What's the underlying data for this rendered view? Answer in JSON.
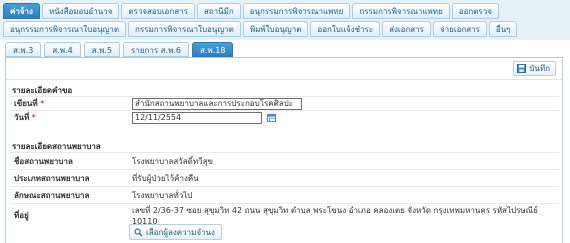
{
  "tabs_row1": [
    {
      "label": "ค่าจ้าง",
      "active": true
    },
    {
      "label": "หนังสือมอบอำนาจ",
      "active": false
    },
    {
      "label": "ตรวจสอบเอกสาร",
      "active": false
    },
    {
      "label": "สถานีมีก",
      "active": false
    },
    {
      "label": "อนุกรรมการพิจารณาแพทย",
      "active": false
    },
    {
      "label": "กรรมการพิจารณาแพทย",
      "active": false
    },
    {
      "label": "ออกตรวจ",
      "active": false
    }
  ],
  "tabs_row2": [
    {
      "label": "อนุกรรมการพิจารณาใบอนุญาต",
      "active": false
    },
    {
      "label": "กรรมการพิจารณาใบอนุญาต",
      "active": false
    },
    {
      "label": "พิมพ์ใบอนุญาต",
      "active": false
    },
    {
      "label": "ออกใบแจ้งชำระ",
      "active": false
    },
    {
      "label": "ส่งเอกสาร",
      "active": false
    },
    {
      "label": "จ่ายเอกสาร",
      "active": false
    },
    {
      "label": "อื่นๆ",
      "active": false
    }
  ],
  "subtabs": [
    {
      "label": "ส.พ.3",
      "active": false
    },
    {
      "label": "ส.พ.4",
      "active": false
    },
    {
      "label": "ส.พ.5",
      "active": false
    },
    {
      "label": "รายการ ส.พ.6",
      "active": false
    },
    {
      "label": "ส.พ.18",
      "active": true
    }
  ],
  "toolbar": {
    "save_label": "บันทึก"
  },
  "request_section": {
    "title": "รายละเอียดคำขอ",
    "write_at_label": "เขียนที่",
    "write_at_value": "สำนักสถานพยาบาลและการประกอบโรคศิลปะ",
    "date_label": "วันที่",
    "date_value": "12/11/2554"
  },
  "hospital_section": {
    "title": "รายละเอียดสถานพยาบาล",
    "rows": [
      {
        "label": "ชื่อสถานพยาบาล",
        "value": "โรงพยาบาลสวัสดิ์ทวีสุข"
      },
      {
        "label": "ประเภทสถานพยาบาล",
        "value": "ที่รับผู้ป่วยไว้ค้างคืน"
      },
      {
        "label": "ลักษณะสถานพยาบาล",
        "value": "โรงพยาบาลทั่วไป"
      },
      {
        "label": "ที่อยู่",
        "value": "เลขที่ 2/36-37 ซอย สุขุมวิท 42 ถนน สุขุมวิท ตำบล พระโขนง อำเภอ คลองเตย จังหวัด กรุงเทพมหานคร รหัสไปรษณีย์ 10110"
      }
    ]
  },
  "choose_button": {
    "label": "เลือกผู้ลงความจำนง"
  },
  "colors": {
    "accent": "#2b7fbf",
    "tab_bg": "#e6f1f8",
    "required": "#dd0000"
  }
}
